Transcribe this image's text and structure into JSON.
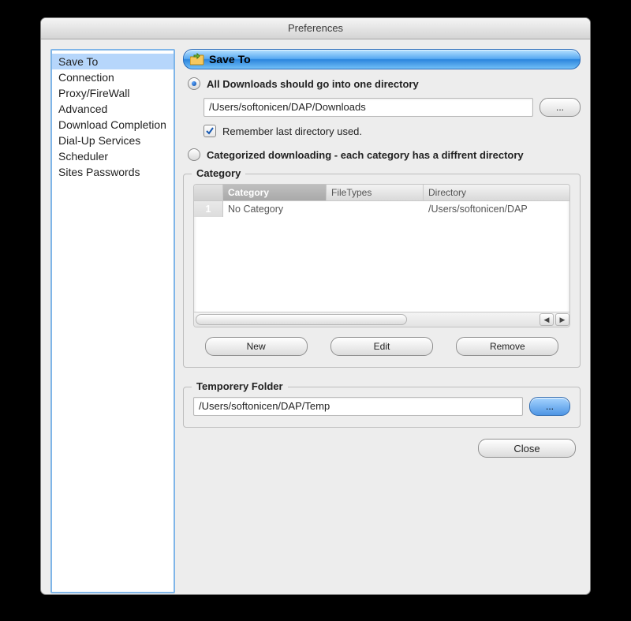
{
  "window": {
    "title": "Preferences"
  },
  "sidebar": {
    "items": [
      "Save To",
      "Connection",
      "Proxy/FireWall",
      "Advanced",
      "Download Completion",
      "Dial-Up Services",
      "Scheduler",
      "Sites Passwords"
    ],
    "selected_index": 0
  },
  "section": {
    "title": "Save To"
  },
  "radios": {
    "all_label": "All Downloads should go into one directory",
    "categorized_label": "Categorized downloading - each category has a diffrent directory",
    "selected": "all"
  },
  "download_path": "/Users/softonicen/DAP/Downloads",
  "browse_label": "...",
  "remember": {
    "checked": true,
    "label": "Remember last directory used."
  },
  "category_box": {
    "legend": "Category",
    "columns": {
      "category": "Category",
      "filetypes": "FileTypes",
      "directory": "Directory"
    },
    "rows": [
      {
        "n": "1",
        "category": "No Category",
        "filetypes": "",
        "directory": "/Users/softonicen/DAP"
      }
    ],
    "buttons": {
      "new": "New",
      "edit": "Edit",
      "remove": "Remove"
    }
  },
  "temp_box": {
    "legend": "Temporery Folder",
    "path": "/Users/softonicen/DAP/Temp",
    "browse_label": "..."
  },
  "footer": {
    "close": "Close"
  }
}
